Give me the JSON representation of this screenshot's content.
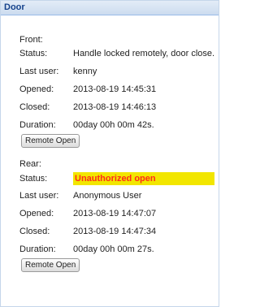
{
  "panel": {
    "title": "Door"
  },
  "front": {
    "heading": "Front:",
    "status_label": "Status:",
    "status_value": "Handle locked remotely, door close.",
    "last_user_label": "Last user:",
    "last_user_value": "kenny",
    "opened_label": "Opened:",
    "opened_value": "2013-08-19 14:45:31",
    "closed_label": "Closed:",
    "closed_value": "2013-08-19 14:46:13",
    "duration_label": "Duration:",
    "duration_value": "00day 00h 00m 42s.",
    "remote_open_label": "Remote Open"
  },
  "rear": {
    "heading": "Rear:",
    "status_label": "Status:",
    "status_value": "Unauthorized open",
    "status_highlight_color": "#f2e600",
    "status_text_color": "#ff2a1a",
    "last_user_label": "Last user:",
    "last_user_value": "Anonymous User",
    "opened_label": "Opened:",
    "opened_value": "2013-08-19 14:47:07",
    "closed_label": "Closed:",
    "closed_value": "2013-08-19 14:47:34",
    "duration_label": "Duration:",
    "duration_value": "00day 00h 00m 27s.",
    "remote_open_label": "Remote Open"
  }
}
